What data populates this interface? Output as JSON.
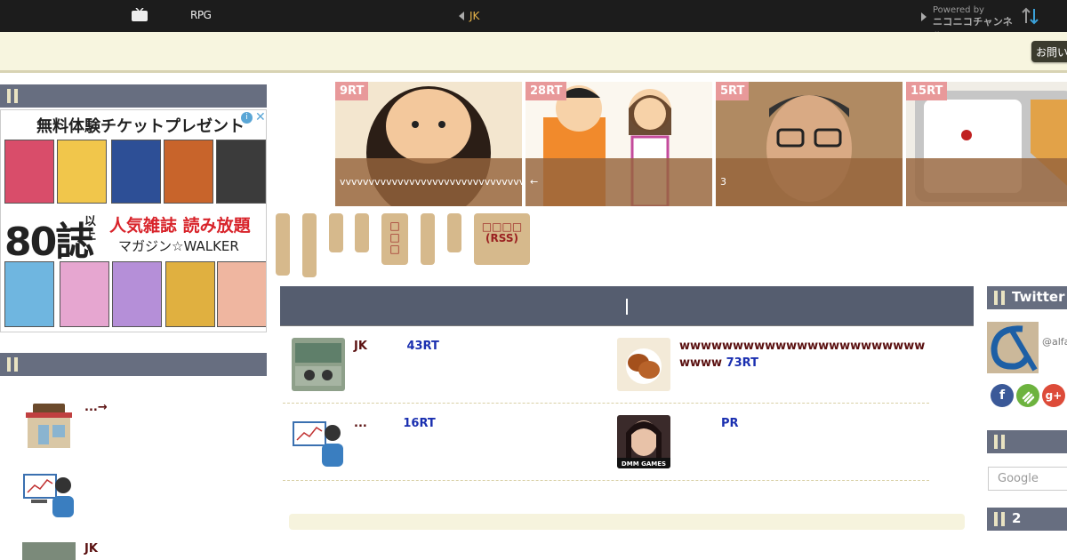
{
  "topbar": {
    "site_name": "RPG",
    "prev_label": "JK",
    "powered_small": "Powered by",
    "powered_big": "ニコニコチャンネル"
  },
  "header": {
    "contact_label": "お問い"
  },
  "left_sidebar": {
    "ad": {
      "title": "無料体験チケットプレゼント",
      "big_number": "80誌",
      "big_small": "以上",
      "headline": "人気雑誌 読み放題",
      "brand": "マガジン☆WALKER",
      "info": "i",
      "close": "✕"
    },
    "items": [
      {
        "text": "...→"
      },
      {
        "text": ""
      },
      {
        "text": "JK"
      }
    ]
  },
  "carousel": [
    {
      "rt": "9RT",
      "caption": "vvvvvvvvvvvvvvvvvvvvvvvvvvvvvvvv"
    },
    {
      "rt": "28RT",
      "caption": "←"
    },
    {
      "rt": "5RT",
      "caption": "3"
    },
    {
      "rt": "15RT",
      "caption": ""
    }
  ],
  "categories": {
    "rss_label": "(RSS)"
  },
  "ranking": [
    {
      "title": "JK",
      "count": "43RT"
    },
    {
      "title": "wwwwwwwwwwwwwwwwwwwwwwwwwww",
      "count": "73RT"
    },
    {
      "title": "...",
      "count": "16RT"
    },
    {
      "title": "",
      "count": "PR"
    }
  ],
  "right_sidebar": {
    "twitter_title": "Twitter",
    "twitter_handle": "@alfa",
    "search_placeholder": "Google",
    "section3_title": "2",
    "social": [
      "f",
      "",
      "g+"
    ]
  }
}
